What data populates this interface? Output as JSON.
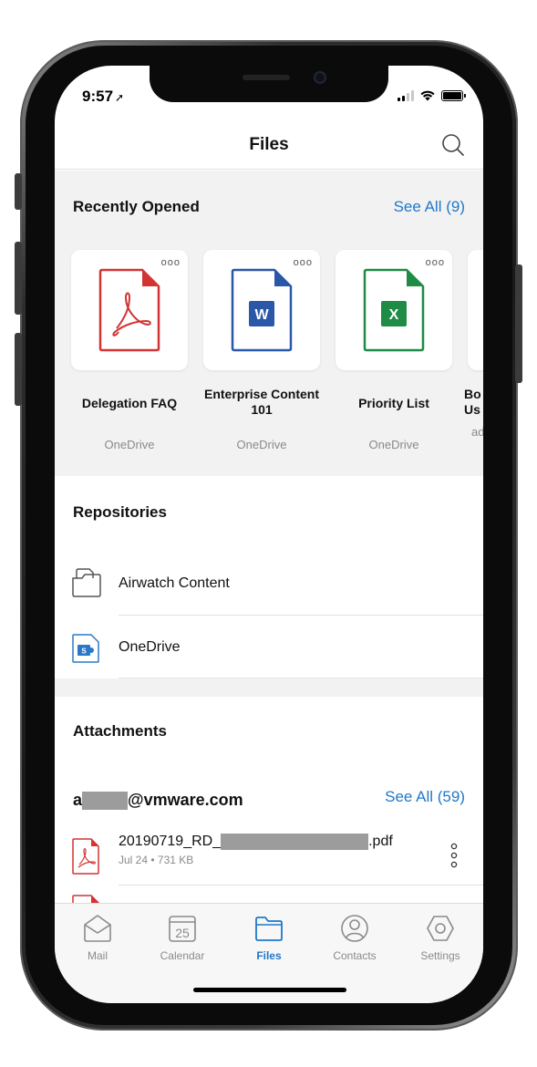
{
  "status": {
    "time": "9:57",
    "location_glyph": "➚"
  },
  "navbar": {
    "title": "Files"
  },
  "recent": {
    "title": "Recently Opened",
    "see_all": "See All (9)",
    "more_glyph": "ooo",
    "cards": [
      {
        "name": "Delegation FAQ",
        "source": "OneDrive",
        "type": "pdf",
        "color": "#d23434"
      },
      {
        "name": "Enterprise Content 101",
        "source": "OneDrive",
        "type": "word",
        "color": "#2b57a8"
      },
      {
        "name": "Priority List",
        "source": "OneDrive",
        "type": "excel",
        "color": "#1e8c45"
      },
      {
        "name": "Bo Us",
        "source": "ad",
        "type": "partial",
        "color": "#999999"
      }
    ]
  },
  "repositories": {
    "title": "Repositories",
    "items": [
      {
        "label": "Airwatch Content",
        "icon": "folder-icon"
      },
      {
        "label": "OneDrive",
        "icon": "sharepoint-icon"
      }
    ]
  },
  "attachments": {
    "title": "Attachments",
    "email_prefix": "a",
    "email_suffix": "@vmware.com",
    "see_all": "See All (59)",
    "files": [
      {
        "name_prefix": "20190719_RD_",
        "name_suffix": ".pdf",
        "meta": "Jul 24 • 731 KB"
      }
    ]
  },
  "tabs": [
    {
      "label": "Mail",
      "icon": "mail-icon",
      "active": false
    },
    {
      "label": "Calendar",
      "icon": "calendar-icon",
      "date": "25",
      "active": false
    },
    {
      "label": "Files",
      "icon": "folder-icon",
      "active": true
    },
    {
      "label": "Contacts",
      "icon": "contacts-icon",
      "active": false
    },
    {
      "label": "Settings",
      "icon": "settings-icon",
      "active": false
    }
  ],
  "colors": {
    "accent": "#1f78c8",
    "pdf": "#d23434",
    "word": "#2b57a8",
    "excel": "#1e8c45"
  }
}
